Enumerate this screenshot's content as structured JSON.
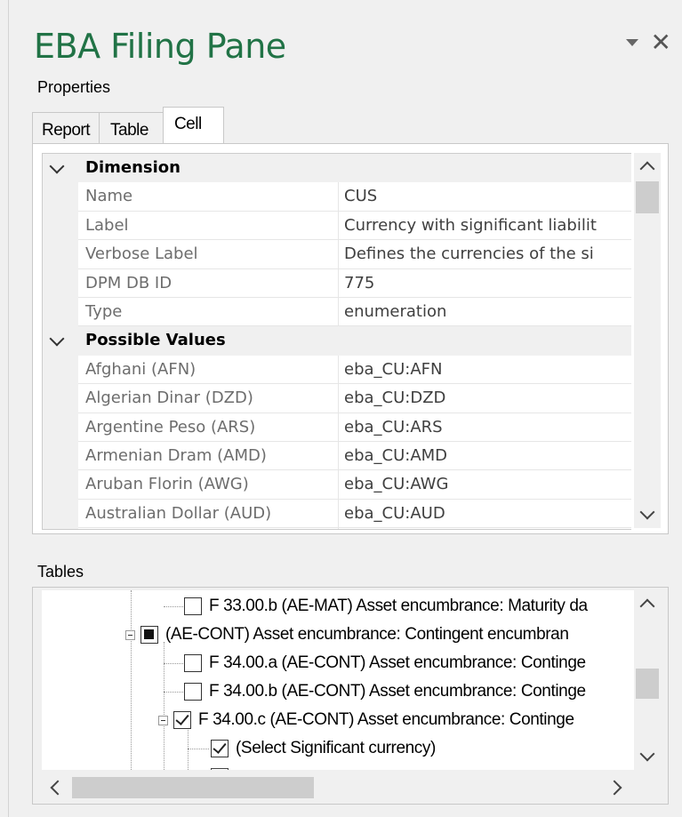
{
  "pane": {
    "title": "EBA Filing Pane"
  },
  "properties": {
    "group_label": "Properties",
    "tabs": [
      {
        "label": "Report"
      },
      {
        "label": "Table"
      },
      {
        "label": "Cell"
      }
    ],
    "active_tab": "Cell",
    "sections": [
      {
        "title": "Dimension",
        "rows": [
          {
            "name": "Name",
            "value": "CUS"
          },
          {
            "name": "Label",
            "value": "Currency with significant liabilit"
          },
          {
            "name": "Verbose Label",
            "value": "Defines the currencies of the si"
          },
          {
            "name": "DPM DB ID",
            "value": "775"
          },
          {
            "name": "Type",
            "value": "enumeration"
          }
        ]
      },
      {
        "title": "Possible Values",
        "rows": [
          {
            "name": "Afghani (AFN)",
            "value": "eba_CU:AFN"
          },
          {
            "name": "Algerian Dinar (DZD)",
            "value": "eba_CU:DZD"
          },
          {
            "name": "Argentine Peso (ARS)",
            "value": "eba_CU:ARS"
          },
          {
            "name": "Armenian Dram (AMD)",
            "value": "eba_CU:AMD"
          },
          {
            "name": "Aruban Florin (AWG)",
            "value": "eba_CU:AWG"
          },
          {
            "name": "Australian Dollar (AUD)",
            "value": "eba_CU:AUD"
          }
        ]
      }
    ]
  },
  "tables": {
    "group_label": "Tables",
    "items": [
      {
        "label": "F 33.00.b (AE-MAT) Asset encumbrance: Maturity da",
        "check": "unchecked"
      },
      {
        "label": "(AE-CONT) Asset encumbrance: Contingent encumbran",
        "check": "partial"
      },
      {
        "label": "F 34.00.a (AE-CONT) Asset encumbrance: Continge",
        "check": "unchecked"
      },
      {
        "label": "F 34.00.b (AE-CONT) Asset encumbrance: Continge",
        "check": "unchecked"
      },
      {
        "label": "F 34.00.c (AE-CONT) Asset encumbrance: Continge",
        "check": "checked"
      },
      {
        "label": "(Select Significant currency)",
        "check": "checked"
      }
    ]
  }
}
